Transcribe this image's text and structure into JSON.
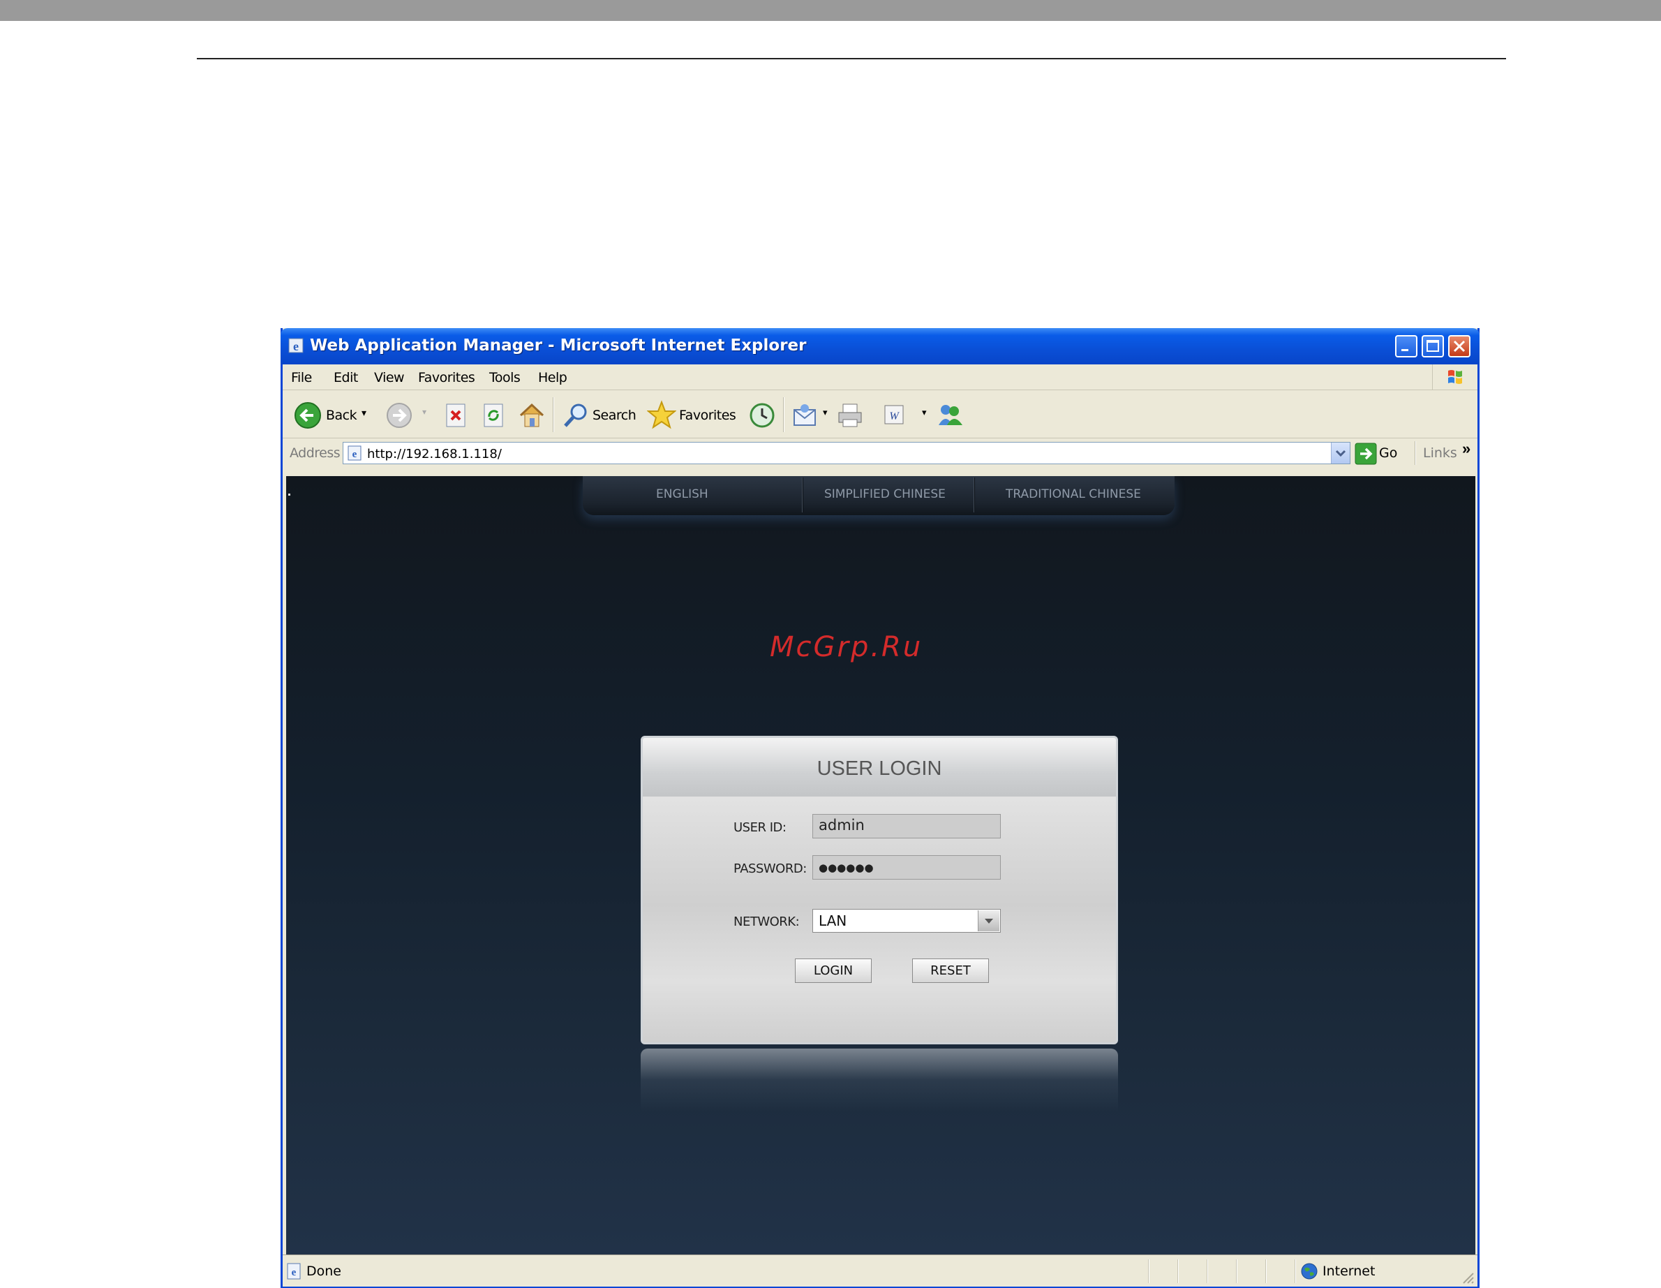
{
  "window": {
    "title": "Web Application Manager - Microsoft Internet Explorer"
  },
  "menu": {
    "items": [
      "File",
      "Edit",
      "View",
      "Favorites",
      "Tools",
      "Help"
    ]
  },
  "toolbar": {
    "back_label": "Back",
    "search_label": "Search",
    "favorites_label": "Favorites"
  },
  "address": {
    "label": "Address",
    "url": "http://192.168.1.118/",
    "go_label": "Go",
    "links_label": "Links"
  },
  "languages": [
    "ENGLISH",
    "SIMPLIFIED CHINESE",
    "TRADITIONAL CHINESE"
  ],
  "watermark": "McGrp.Ru",
  "login": {
    "title": "USER LOGIN",
    "user_id_label": "USER ID:",
    "user_id_value": "admin",
    "password_label": "PASSWORD:",
    "password_value": "●●●●●●",
    "network_label": "NETWORK:",
    "network_value": "LAN",
    "login_button": "LOGIN",
    "reset_button": "RESET"
  },
  "status": {
    "left": "Done",
    "zone": "Internet"
  },
  "colors": {
    "titlebar": "#0a4fd6",
    "page_bg": "#14202d",
    "watermark": "#d42b2b"
  }
}
